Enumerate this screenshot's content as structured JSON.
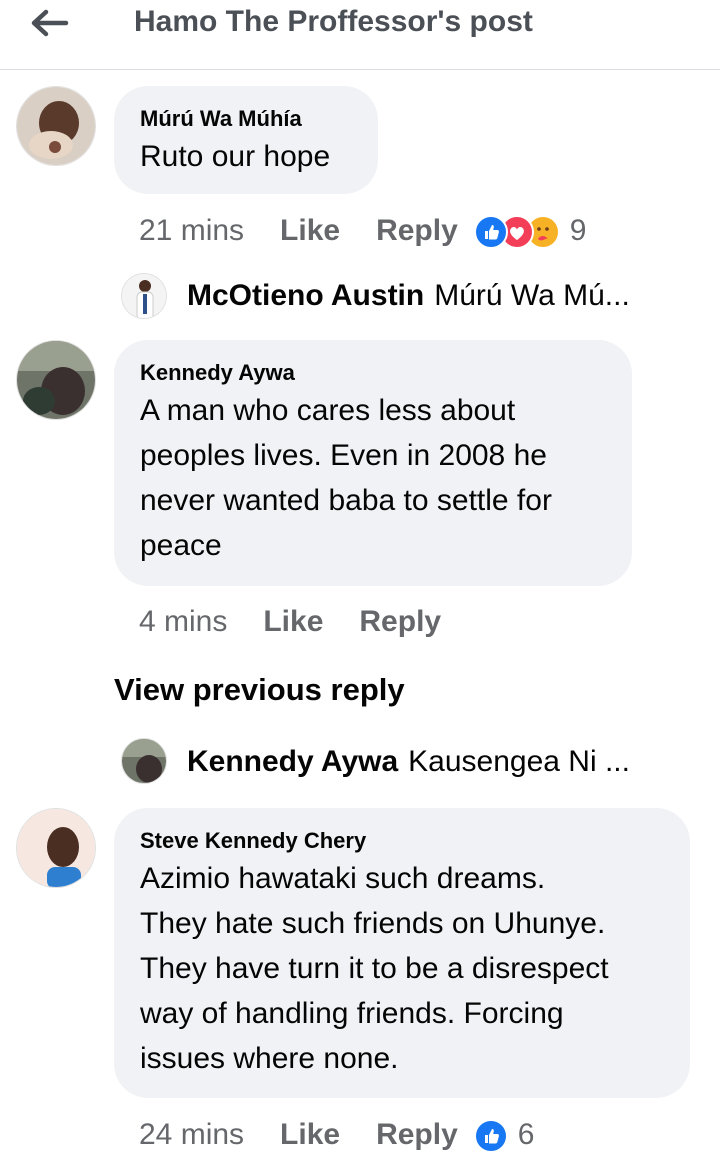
{
  "header": {
    "title": "Hamo The Proffessor's post",
    "back_icon": "arrow-left-icon"
  },
  "comments": [
    {
      "author": "Múrú Wa Múhía",
      "text": "Ruto our hope",
      "time": "21 mins",
      "like": "Like",
      "reply": "Reply",
      "reaction_count": "9",
      "reactions": [
        "like-reaction-icon",
        "love-reaction-icon",
        "care-reaction-icon"
      ],
      "reply_preview": {
        "name": "McOtieno Austin",
        "snippet": "Múrú Wa Mú..."
      }
    },
    {
      "author": "Kennedy Aywa",
      "lines": [
        "A man who cares less about",
        "peoples lives. Even in 2008 he",
        "never wanted baba to settle for",
        "peace"
      ],
      "time": "4 mins",
      "like": "Like",
      "reply": "Reply",
      "view_previous": "View previous reply",
      "reply_preview": {
        "name": "Kennedy Aywa",
        "snippet": "Kausengea Ni ..."
      }
    },
    {
      "author": "Steve Kennedy Chery",
      "lines": [
        "Azimio hawataki such dreams.",
        "They hate such friends on Uhunye.",
        "They have turn it to be a disrespect",
        "way of handling friends. Forcing",
        "issues where none."
      ],
      "time": "24 mins",
      "like": "Like",
      "reply": "Reply",
      "reaction_count": "6",
      "reactions": [
        "like-reaction-icon"
      ]
    }
  ],
  "colors": {
    "like_blue": "#1877f2",
    "love_red": "#f33e58",
    "care_yellow": "#f7b125",
    "bubble": "#f0f2f5",
    "meta": "#65676b"
  }
}
